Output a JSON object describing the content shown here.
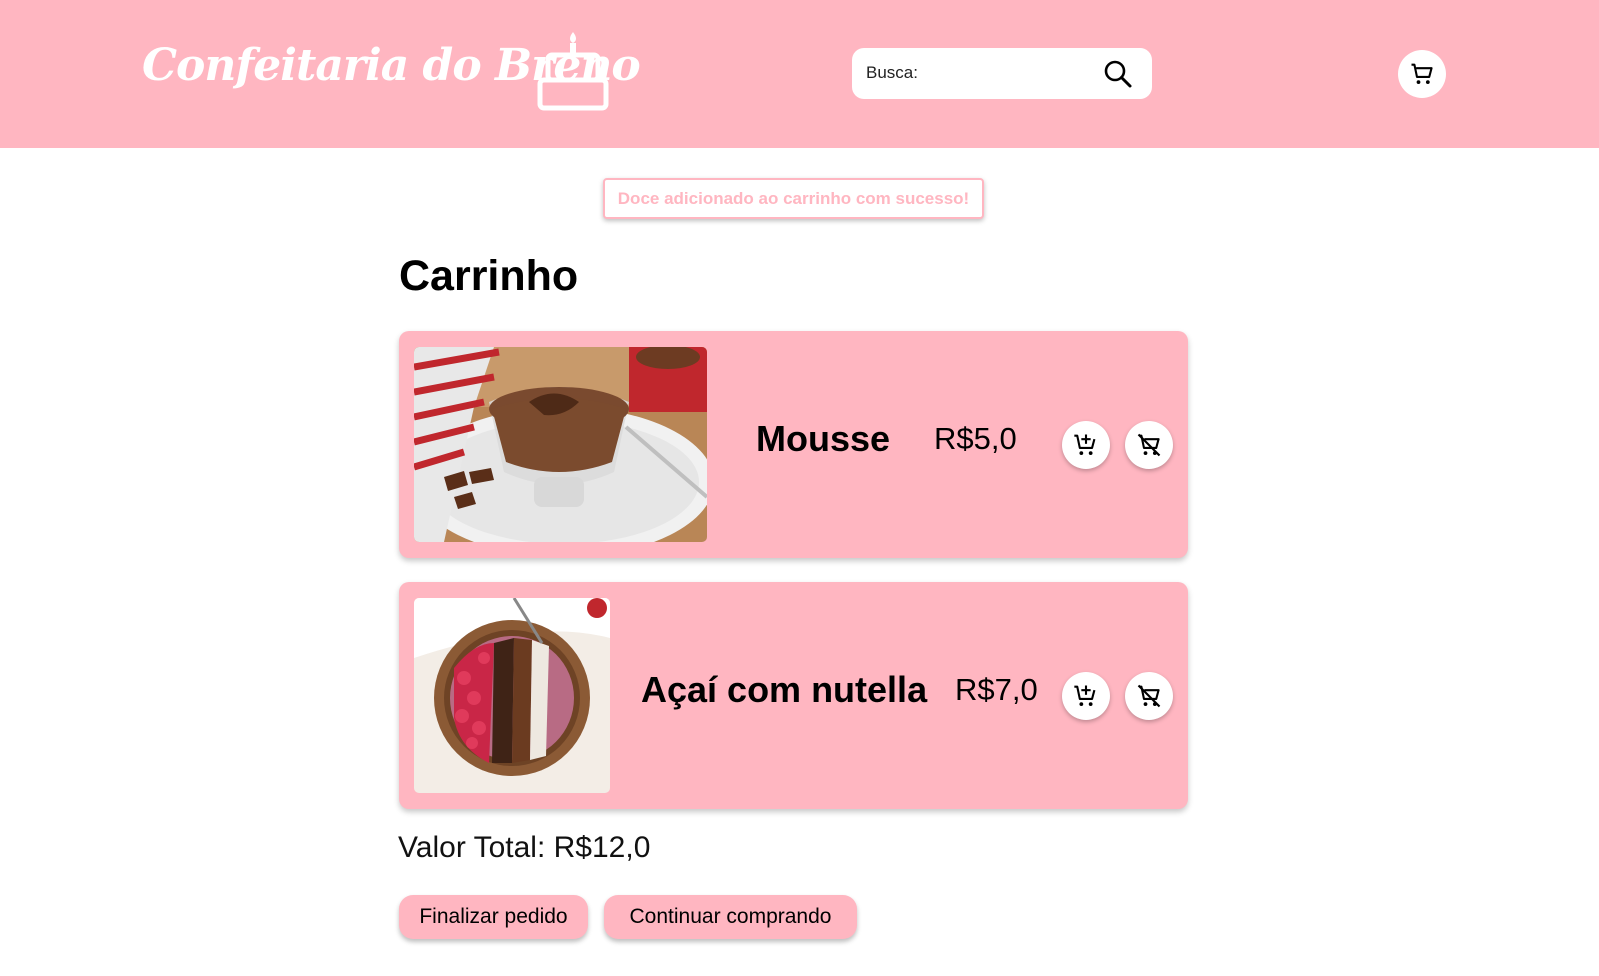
{
  "colors": {
    "brand": "#ffb6c1",
    "text": "#000000",
    "white": "#ffffff"
  },
  "header": {
    "brand_name": "Confeitaria do Breno",
    "logo_icon": "cake-icon",
    "search": {
      "label": "Busca:",
      "value": "",
      "icon": "search-icon"
    },
    "cart_icon": "shopping-cart-icon"
  },
  "toast": {
    "message": "Doce adicionado ao carrinho com sucesso!"
  },
  "page": {
    "title": "Carrinho"
  },
  "cart": {
    "items": [
      {
        "name": "Mousse",
        "price": "R$5,0",
        "add_icon": "cart-plus-icon",
        "remove_icon": "cart-remove-icon"
      },
      {
        "name": "Açaí com nutella",
        "price": "R$7,0",
        "add_icon": "cart-plus-icon",
        "remove_icon": "cart-remove-icon"
      }
    ],
    "total": "Valor Total: R$12,0"
  },
  "actions": {
    "checkout": "Finalizar pedido",
    "continue": "Continuar comprando"
  }
}
